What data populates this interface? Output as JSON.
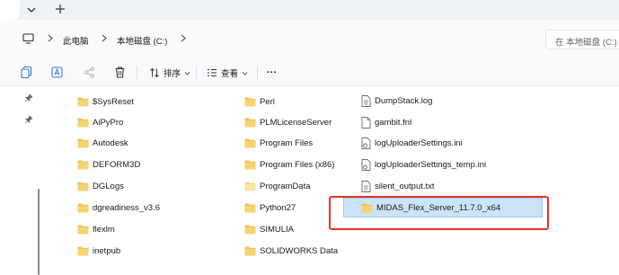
{
  "breadcrumb": {
    "pc": "此电脑",
    "drive": "本地磁盘 (C:)"
  },
  "search": {
    "placeholder": "在 本地磁盘 (C:)"
  },
  "toolbar": {
    "sort_label": "排序",
    "view_label": "查看",
    "more_label": "···"
  },
  "columns": [
    {
      "items": [
        {
          "name": "$SysReset",
          "type": "folder"
        },
        {
          "name": "AiPyPro",
          "type": "folder"
        },
        {
          "name": "Autodesk",
          "type": "folder"
        },
        {
          "name": "DEFORM3D",
          "type": "folder"
        },
        {
          "name": "DGLogs",
          "type": "folder"
        },
        {
          "name": "dgreadiness_v3.6",
          "type": "folder"
        },
        {
          "name": "flexlm",
          "type": "folder"
        },
        {
          "name": "inetpub",
          "type": "folder"
        }
      ]
    },
    {
      "items": [
        {
          "name": "Perl",
          "type": "folder"
        },
        {
          "name": "PLMLicenseServer",
          "type": "folder"
        },
        {
          "name": "Program Files",
          "type": "folder"
        },
        {
          "name": "Program Files (x86)",
          "type": "folder"
        },
        {
          "name": "ProgramData",
          "type": "folder-light"
        },
        {
          "name": "Python27",
          "type": "folder"
        },
        {
          "name": "SIMULIA",
          "type": "folder"
        },
        {
          "name": "SOLIDWORKS Data",
          "type": "folder"
        }
      ]
    },
    {
      "items": [
        {
          "name": "DumpStack.log",
          "type": "text-file"
        },
        {
          "name": "gambit.fnl",
          "type": "file"
        },
        {
          "name": "logUploaderSettings.ini",
          "type": "settings-file"
        },
        {
          "name": "logUploaderSettings_temp.ini",
          "type": "settings-file"
        },
        {
          "name": "silent_output.txt",
          "type": "text-file"
        },
        {
          "name": "MIDAS_Flex_Server_11.7.0_x64",
          "type": "folder",
          "selected": true
        }
      ]
    }
  ],
  "colors": {
    "folder": "#f2c14e",
    "folder_light": "#f7dc94",
    "selection": "#cce4f7",
    "highlight_box": "#e8322b"
  }
}
